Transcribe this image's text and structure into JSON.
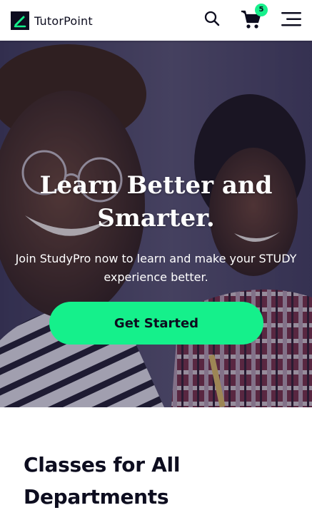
{
  "header": {
    "brand": "TutorPoint",
    "cart_count": "5",
    "icons": {
      "logo": "pen-logo-icon",
      "search": "search-icon",
      "cart": "cart-icon",
      "menu": "hamburger-menu-icon"
    }
  },
  "hero": {
    "title": "Learn Better and Smarter.",
    "subtitle": "Join StudyPro now to learn and make your STUDY experience better.",
    "cta_label": "Get Started",
    "background": "students-photo"
  },
  "section": {
    "title": "Classes for All Departments"
  },
  "colors": {
    "accent": "#15f08b",
    "text_dark": "#0d0d1f",
    "hero_overlay": "#1c1a3a",
    "white": "#ffffff"
  }
}
